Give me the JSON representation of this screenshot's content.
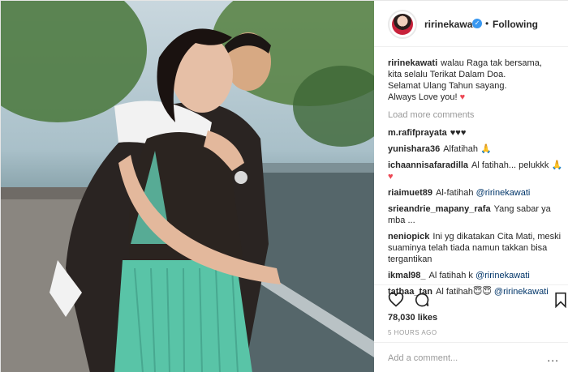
{
  "post": {
    "username": "ririnekawati",
    "follow_status": "Following",
    "dot": "•",
    "verified_icon": "verified-badge-icon"
  },
  "caption": {
    "username": "ririnekawati",
    "lines": [
      "walau Raga tak bersama,",
      "kita selalu Terikat Dalam Doa.",
      "Selamat Ulang Tahun sayang.",
      "Always Love you!"
    ],
    "emoji": "♥"
  },
  "load_more": "Load more comments",
  "comments": [
    {
      "username": "m.rafifprayata",
      "text": "♥♥♥"
    },
    {
      "username": "yunishara36",
      "text": "Alfatihah 🙏"
    },
    {
      "username": "ichaannisafaradilla",
      "text": "Al fatihah... pelukkk 🙏",
      "extra": "♥"
    },
    {
      "username": "riaimuet89",
      "text": "Al-fatihah",
      "mention": "@ririnekawati"
    },
    {
      "username": "srieandrie_mapany_rafa",
      "text": "Yang sabar ya mba ..."
    },
    {
      "username": "neniopick",
      "text": "Ini yg dikatakan Cita Mati, meski suaminya telah tiada namun takkan bisa tergantikan"
    },
    {
      "username": "ikmal98_",
      "text": "Al fatihah k",
      "mention": "@ririnekawati"
    },
    {
      "username": "tathaa_tan",
      "text": "Al fatihah😇😇",
      "mention": "@ririnekawati"
    }
  ],
  "actions": {
    "like_icon": "heart-icon",
    "comment_icon": "comment-bubble-icon",
    "save_icon": "bookmark-icon"
  },
  "likes": "78,030 likes",
  "timestamp": "5 HOURS AGO",
  "add_comment": {
    "placeholder": "Add a comment...",
    "more": "..."
  },
  "colors": {
    "accent_blue": "#3897f0",
    "mention_blue": "#003569",
    "muted_gray": "#999999",
    "heart_red": "#ed4956"
  }
}
